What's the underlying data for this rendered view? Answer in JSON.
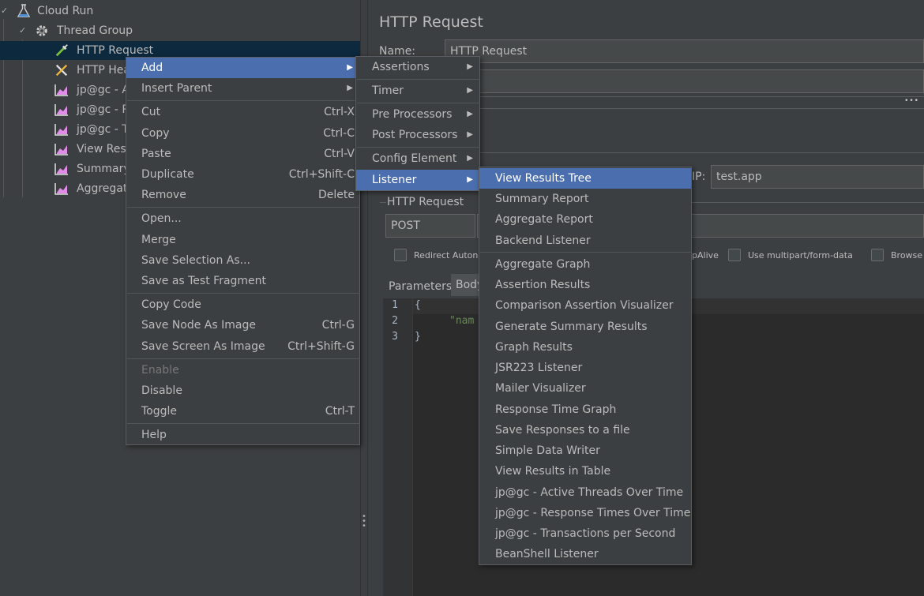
{
  "tree": {
    "items": [
      {
        "label": "Cloud Run",
        "icon": "flask-icon"
      },
      {
        "label": "Thread Group",
        "icon": "gear-icon"
      },
      {
        "label": "HTTP Request",
        "icon": "pipette-icon"
      },
      {
        "label": "HTTP Hea",
        "icon": "wrench-screwdriver-icon"
      },
      {
        "label": "jp@gc - A",
        "icon": "chart-icon"
      },
      {
        "label": "jp@gc - R",
        "icon": "chart-icon"
      },
      {
        "label": "jp@gc - T",
        "icon": "chart-icon"
      },
      {
        "label": "View Resu",
        "icon": "chart-icon"
      },
      {
        "label": "Summary",
        "icon": "chart-icon"
      },
      {
        "label": "Aggregat",
        "icon": "chart-icon"
      }
    ]
  },
  "panel": {
    "title": "HTTP Request",
    "name_label": "Name:",
    "name_value": "HTTP Request",
    "more_dots": "•••",
    "ip_label": "IP:",
    "ip_value": "test.app",
    "http_request_label": "HTTP Request",
    "method_value": "POST",
    "checkboxes": {
      "redirect": "Redirect Auton",
      "keepalive": "pAlive",
      "multipart": "Use multipart/form-data",
      "browser": "Browse"
    },
    "tabs": {
      "parameters": "Parameters",
      "body": "Body"
    },
    "editor": {
      "line_numbers": [
        "1",
        "2",
        "3"
      ],
      "line1": "{",
      "line2": "\"nam",
      "line3": "}"
    }
  },
  "splitter_dots": "⋮",
  "menus": {
    "context": {
      "add": "Add",
      "insert_parent": "Insert Parent",
      "cut": "Cut",
      "cut_sc": "Ctrl-X",
      "copy": "Copy",
      "copy_sc": "Ctrl-C",
      "paste": "Paste",
      "paste_sc": "Ctrl-V",
      "duplicate": "Duplicate",
      "duplicate_sc": "Ctrl+Shift-C",
      "remove": "Remove",
      "remove_sc": "Delete",
      "open": "Open...",
      "merge": "Merge",
      "save_selection": "Save Selection As...",
      "save_fragment": "Save as Test Fragment",
      "copy_code": "Copy Code",
      "save_node_image": "Save Node As Image",
      "save_node_image_sc": "Ctrl-G",
      "save_screen_image": "Save Screen As Image",
      "save_screen_image_sc": "Ctrl+Shift-G",
      "enable": "Enable",
      "disable": "Disable",
      "toggle": "Toggle",
      "toggle_sc": "Ctrl-T",
      "help": "Help"
    },
    "add": {
      "assertions": "Assertions",
      "timer": "Timer",
      "pre_processors": "Pre Processors",
      "post_processors": "Post Processors",
      "config_element": "Config Element",
      "listener": "Listener"
    },
    "listener": [
      "View Results Tree",
      "Summary Report",
      "Aggregate Report",
      "Backend Listener",
      "Aggregate Graph",
      "Assertion Results",
      "Comparison Assertion Visualizer",
      "Generate Summary Results",
      "Graph Results",
      "JSR223 Listener",
      "Mailer Visualizer",
      "Response Time Graph",
      "Save Responses to a file",
      "Simple Data Writer",
      "View Results in Table",
      "jp@gc - Active Threads Over Time",
      "jp@gc - Response Times Over Time",
      "jp@gc - Transactions per Second",
      "BeanShell Listener"
    ]
  },
  "colors": {
    "background": "#3c3f41",
    "highlight": "#4b6eaf",
    "selection": "#0d293e",
    "editor": "#2b2b2b"
  }
}
